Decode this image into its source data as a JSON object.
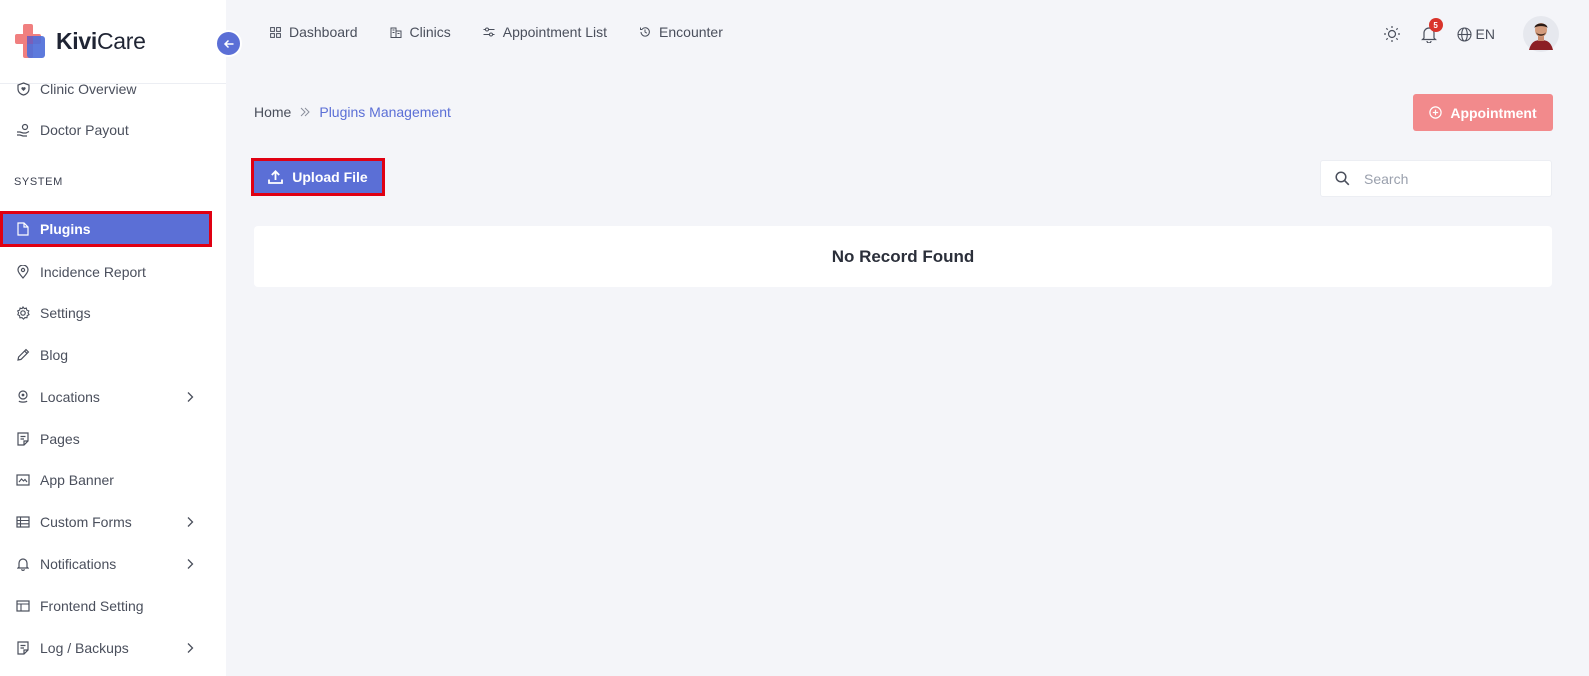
{
  "brand": {
    "name_bold": "Kivi",
    "name_light": "Care"
  },
  "sidebar": {
    "items": [
      {
        "label": "Clinic Overview",
        "icon": "shield-heart-icon"
      },
      {
        "label": "Doctor Payout",
        "icon": "hand-coin-icon"
      },
      {
        "label": "Plugins",
        "icon": "file-icon",
        "active": true
      },
      {
        "label": "Incidence Report",
        "icon": "map-pin-icon"
      },
      {
        "label": "Settings",
        "icon": "gear-icon"
      },
      {
        "label": "Blog",
        "icon": "pencil-icon"
      },
      {
        "label": "Locations",
        "icon": "location-pin-icon",
        "has_children": true
      },
      {
        "label": "Pages",
        "icon": "page-icon"
      },
      {
        "label": "App Banner",
        "icon": "image-icon"
      },
      {
        "label": "Custom Forms",
        "icon": "table-icon",
        "has_children": true
      },
      {
        "label": "Notifications",
        "icon": "bell-icon",
        "has_children": true
      },
      {
        "label": "Frontend Setting",
        "icon": "layout-icon"
      },
      {
        "label": "Log / Backups",
        "icon": "document-icon",
        "has_children": true
      }
    ],
    "section_system": "SYSTEM"
  },
  "topnav": {
    "links": [
      {
        "label": "Dashboard",
        "icon": "grid-icon"
      },
      {
        "label": "Clinics",
        "icon": "building-icon"
      },
      {
        "label": "Appointment List",
        "icon": "sliders-icon"
      },
      {
        "label": "Encounter",
        "icon": "history-icon"
      }
    ],
    "notification_count": "5",
    "language": "EN"
  },
  "breadcrumb": {
    "home": "Home",
    "current": "Plugins Management"
  },
  "actions": {
    "appointment_label": "Appointment",
    "upload_label": "Upload File"
  },
  "search": {
    "placeholder": "Search",
    "value": ""
  },
  "table": {
    "empty_message": "No Record Found"
  },
  "colors": {
    "primary": "#5b6fd6",
    "appointment": "#f28a8c",
    "highlight": "#e00012",
    "badge": "#d9342b"
  }
}
